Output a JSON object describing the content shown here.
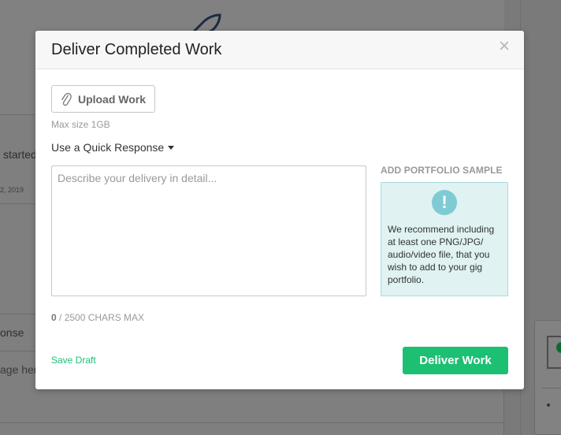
{
  "modal": {
    "title": "Deliver Completed Work",
    "close_glyph": "×",
    "upload_label": "Upload Work",
    "upload_icon": "paperclip-icon",
    "max_size": "Max size 1GB",
    "quick_response_label": "Use a Quick Response",
    "description_placeholder": "Describe your delivery in detail...",
    "description_value": "",
    "char_count_current": "0",
    "char_count_suffix": " / 2500 CHARS MAX",
    "portfolio_label": "ADD PORTFOLIO SAMPLE",
    "portfolio_icon": "exclamation-icon",
    "portfolio_icon_glyph": "!",
    "portfolio_text": "We recommend including at least one PNG/JPG/ audio/video file, that you wish to add to your gig portfolio.",
    "save_draft_label": "Save Draft",
    "deliver_label": "Deliver Work"
  },
  "background": {
    "text_started": "started",
    "text_date": "2, 2019",
    "text_response": "onse",
    "text_message": "age here"
  },
  "colors": {
    "accent_green": "#1dbf73",
    "portfolio_bg": "#e0f2f2",
    "portfolio_border": "#a9dbdf",
    "portfolio_icon": "#7fcbd4",
    "overlay": "#7f7f7f"
  }
}
